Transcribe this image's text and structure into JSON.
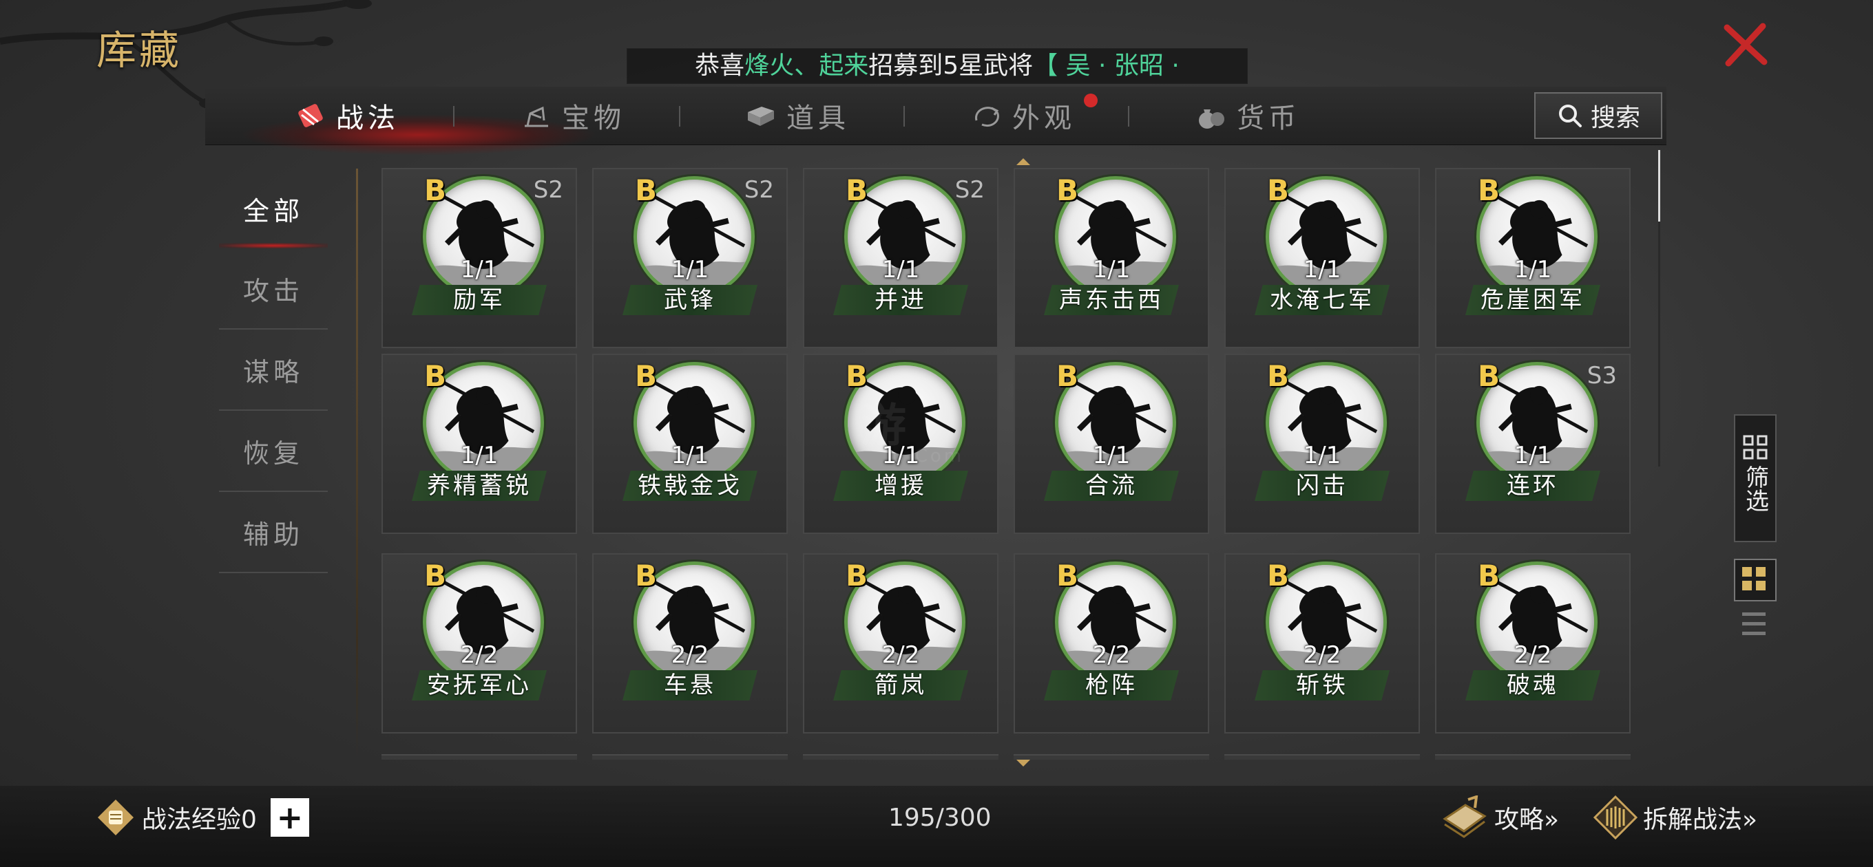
{
  "header": {
    "title": "库藏",
    "announcement": {
      "prefix": "恭喜",
      "name1": "烽火",
      "separator": "、",
      "name2": "起来",
      "mid": "招募到5星武将",
      "hero": "【 吴 · 张昭 ·"
    }
  },
  "tabs": [
    {
      "label": "战法",
      "icon": "scroll-icon",
      "active": true
    },
    {
      "label": "宝物",
      "icon": "treasure-icon",
      "active": false
    },
    {
      "label": "道具",
      "icon": "item-box-icon",
      "active": false
    },
    {
      "label": "外观",
      "icon": "appearance-icon",
      "active": false,
      "badge": true
    },
    {
      "label": "货币",
      "icon": "money-bag-icon",
      "active": false
    }
  ],
  "search": {
    "label": "搜索"
  },
  "side_nav": [
    {
      "label": "全部",
      "active": true
    },
    {
      "label": "攻击",
      "active": false
    },
    {
      "label": "谋略",
      "active": false
    },
    {
      "label": "恢复",
      "active": false
    },
    {
      "label": "辅助",
      "active": false
    }
  ],
  "cards": [
    {
      "grade": "B",
      "season": "S2",
      "count": "1/1",
      "name": "励军"
    },
    {
      "grade": "B",
      "season": "S2",
      "count": "1/1",
      "name": "武锋"
    },
    {
      "grade": "B",
      "season": "S2",
      "count": "1/1",
      "name": "并进"
    },
    {
      "grade": "B",
      "season": "",
      "count": "1/1",
      "name": "声东击西"
    },
    {
      "grade": "B",
      "season": "",
      "count": "1/1",
      "name": "水淹七军"
    },
    {
      "grade": "B",
      "season": "",
      "count": "1/1",
      "name": "危崖困军"
    },
    {
      "grade": "B",
      "season": "",
      "count": "1/1",
      "name": "养精蓄锐"
    },
    {
      "grade": "B",
      "season": "",
      "count": "1/1",
      "name": "铁戟金戈"
    },
    {
      "grade": "B",
      "season": "",
      "count": "1/1",
      "name": "增援"
    },
    {
      "grade": "B",
      "season": "",
      "count": "1/1",
      "name": "合流"
    },
    {
      "grade": "B",
      "season": "",
      "count": "1/1",
      "name": "闪击"
    },
    {
      "grade": "B",
      "season": "S3",
      "count": "1/1",
      "name": "连环"
    },
    {
      "grade": "B",
      "season": "",
      "count": "2/2",
      "name": "安抚军心"
    },
    {
      "grade": "B",
      "season": "",
      "count": "2/2",
      "name": "车悬"
    },
    {
      "grade": "B",
      "season": "",
      "count": "2/2",
      "name": "箭岚"
    },
    {
      "grade": "B",
      "season": "",
      "count": "2/2",
      "name": "枪阵"
    },
    {
      "grade": "B",
      "season": "",
      "count": "2/2",
      "name": "斩铁"
    },
    {
      "grade": "B",
      "season": "",
      "count": "2/2",
      "name": "破魂"
    }
  ],
  "filter": {
    "label": "筛选"
  },
  "footer": {
    "exp_label": "战法经验0",
    "plus": "+",
    "capacity": "195/300",
    "guide": "攻略»",
    "dismantle": "拆解战法»"
  },
  "watermark": {
    "main": "游",
    "sub": "u.Com"
  },
  "colors": {
    "title_gold": "#d7b46a",
    "announce_green": "#4fd39a",
    "active_red": "#d42a2a",
    "grade_yellow": "#f2c94c",
    "portrait_ring": "#5f9a47"
  }
}
